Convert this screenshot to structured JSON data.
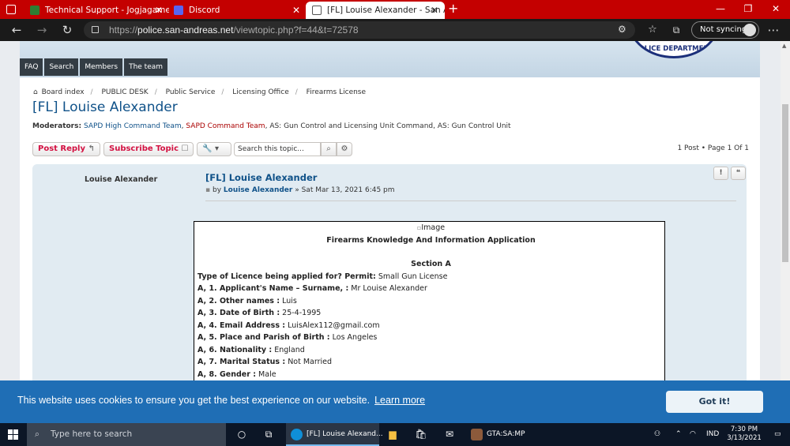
{
  "browser": {
    "tabs": [
      {
        "label": "Technical Support - Jogjagamers"
      },
      {
        "label": "Discord"
      },
      {
        "label": "[FL] Louise Alexander - San Andre"
      }
    ],
    "new_tab_symbol": "+",
    "url_prefix": "https://",
    "url_host": "police.san-andreas.net",
    "url_path": "/viewtopic.php?f=44&t=72578",
    "sync_label": "Not syncing",
    "colors": {
      "tabbar": "#c40000",
      "toolbar": "#1a1a1a"
    }
  },
  "site": {
    "badge_text": "OLICE DEPARTMEN",
    "menu": [
      "FAQ",
      "Search",
      "Members",
      "The team"
    ]
  },
  "topic": {
    "breadcrumbs": [
      "Board index",
      "PUBLIC DESK",
      "Public Service",
      "Licensing Office",
      "Firearms License"
    ],
    "title": "[FL] Louise Alexander",
    "moderators_label": "Moderators:",
    "moderators": [
      {
        "name": "SAPD High Command Team",
        "color": "#105289"
      },
      {
        "name": "SAPD Command Team",
        "color": "#aa0000"
      },
      {
        "name": "AS: Gun Control and Licensing Unit Command",
        "color": "#333333"
      },
      {
        "name": "AS: Gun Control Unit",
        "color": "#333333"
      }
    ],
    "post_reply": "Post Reply",
    "subscribe": "Subscribe Topic",
    "search_placeholder": "Search this topic...",
    "pagination": "1 Post • Page 1 Of 1"
  },
  "post": {
    "author": "Louise Alexander",
    "title": "[FL] Louise Alexander",
    "by": "by",
    "by_author": "Louise Alexander",
    "date": "» Sat Mar 13, 2021 6:45 pm",
    "image_alt": "Image",
    "form_heading": "Firearms Knowledge And Information Application",
    "section": "Section A",
    "fields": [
      {
        "label": "Type of Licence being applied for? Permit:",
        "value": "Small Gun License"
      },
      {
        "label": "A, 1. Applicant's Name – Surname, :",
        "value": "Mr Louise Alexander"
      },
      {
        "label": "A, 2. Other names :",
        "value": "Luis"
      },
      {
        "label": "A, 3. Date of Birth :",
        "value": "25-4-1995"
      },
      {
        "label": "A, 4. Email Address :",
        "value": "LuisAlex112@gmail.com"
      },
      {
        "label": "A, 5. Place and Parish of Birth :",
        "value": "Los Angeles"
      },
      {
        "label": "A, 6. Nationality :",
        "value": "England"
      },
      {
        "label": "A, 7. Marital Status :",
        "value": "Not Married"
      },
      {
        "label": "A, 8. Gender :",
        "value": "Male"
      }
    ]
  },
  "cookie": {
    "message": "This website uses cookies to ensure you get the best experience on our website.",
    "learn_more": "Learn more",
    "button": "Got it!"
  },
  "taskbar": {
    "search_placeholder": "Type here to search",
    "apps": [
      {
        "label": "[FL] Louise Alexand..."
      },
      {
        "label": "GTA:SA:MP"
      }
    ],
    "language": "IND",
    "time": "7:30 PM",
    "date": "3/13/2021"
  }
}
